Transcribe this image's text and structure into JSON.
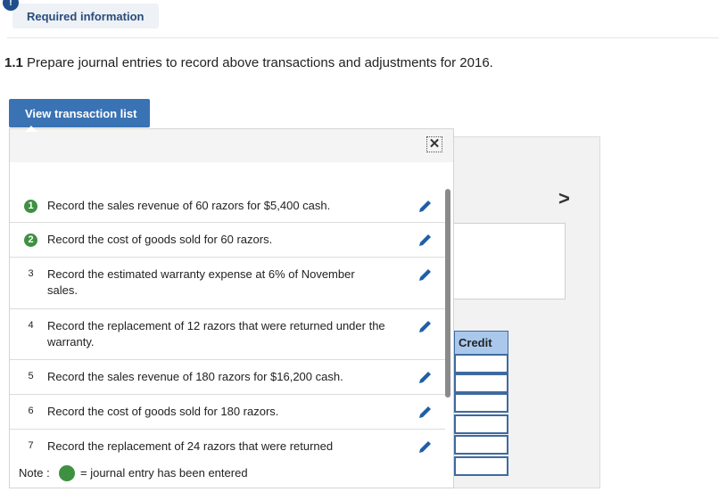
{
  "required_info": {
    "icon": "!",
    "label": "Required information"
  },
  "prompt": {
    "number": "1.1",
    "text": "Prepare journal entries to record above transactions and adjustments for 2016."
  },
  "view_button": {
    "label": "View transaction list"
  },
  "popup": {
    "close_icon": "close-icon",
    "items": [
      {
        "num": "1",
        "done": true,
        "text": "Record the sales revenue of 60 razors for $5,400 cash."
      },
      {
        "num": "2",
        "done": true,
        "text": "Record the cost of goods sold for 60 razors."
      },
      {
        "num": "3",
        "done": false,
        "text": "Record the estimated warranty expense at 6% of November sales."
      },
      {
        "num": "4",
        "done": false,
        "text": "Record the replacement of 12 razors that were returned under the warranty."
      },
      {
        "num": "5",
        "done": false,
        "text": "Record the sales revenue of 180 razors for $16,200 cash."
      },
      {
        "num": "6",
        "done": false,
        "text": "Record the cost of goods sold for 180 razors."
      },
      {
        "num": "7",
        "done": false,
        "text": "Record the replacement of 24 razors that were returned"
      }
    ],
    "note": {
      "label": "Note :",
      "text": "= journal entry has been entered"
    }
  },
  "background": {
    "next_arrow": ">",
    "credit_header": "Credit"
  },
  "colors": {
    "accent": "#3a73b4",
    "done_green": "#3f9142",
    "pencil": "#1f5fa8"
  }
}
